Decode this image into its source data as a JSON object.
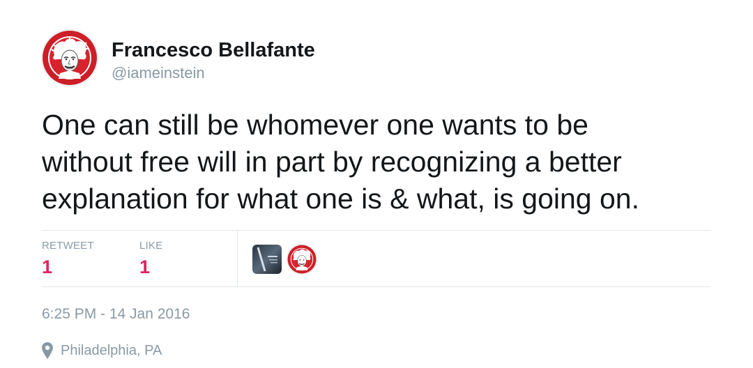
{
  "user": {
    "display_name": "Francesco Bellafante",
    "handle": "@iameinstein",
    "avatar_icon": "einstein-portrait-avatar"
  },
  "tweet": {
    "text_lines": [
      "One can still be whomever one wants to be",
      "without free will in part by recognizing a better",
      "explanation for what one is & what, is going on."
    ]
  },
  "stats": {
    "retweet_label": "RETWEET",
    "retweet_count": "1",
    "like_label": "LIKE",
    "like_count": "1"
  },
  "likers": [
    {
      "avatar_icon": "dark-poster-avatar"
    },
    {
      "avatar_icon": "einstein-portrait-avatar"
    }
  ],
  "meta": {
    "timestamp": "6:25 PM - 14 Jan 2016",
    "location": "Philadelphia, PA",
    "location_icon": "map-pin-icon"
  },
  "colors": {
    "text": "#14171a",
    "muted": "#8899a6",
    "count": "#e0245e",
    "brand_red": "#cc1f28",
    "divider": "#e1e8ed"
  }
}
